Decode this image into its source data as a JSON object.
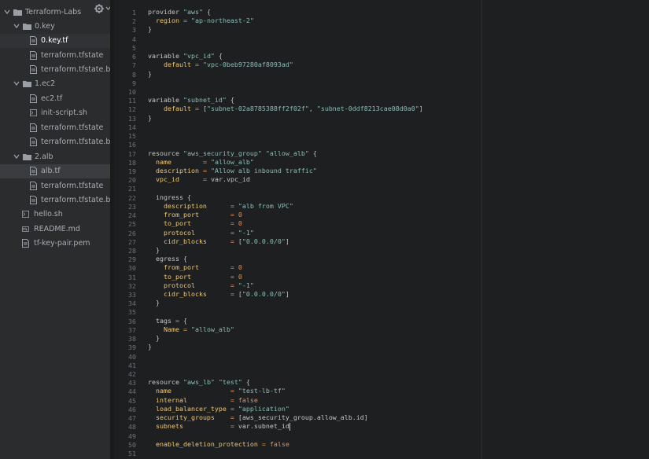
{
  "sidebar": {
    "root": "Terraform-Labs",
    "items": [
      {
        "label": "0.key",
        "type": "folder"
      },
      {
        "label": "0.key.tf",
        "type": "file"
      },
      {
        "label": "terraform.tfstate",
        "type": "file"
      },
      {
        "label": "terraform.tfstate.ba",
        "type": "file"
      },
      {
        "label": "1.ec2",
        "type": "folder"
      },
      {
        "label": "ec2.tf",
        "type": "file"
      },
      {
        "label": "init-script.sh",
        "type": "shell"
      },
      {
        "label": "terraform.tfstate",
        "type": "file"
      },
      {
        "label": "terraform.tfstate.ba",
        "type": "file"
      },
      {
        "label": "2.alb",
        "type": "folder"
      },
      {
        "label": "alb.tf",
        "type": "file"
      },
      {
        "label": "terraform.tfstate",
        "type": "file"
      },
      {
        "label": "terraform.tfstate.ba",
        "type": "file"
      },
      {
        "label": "hello.sh",
        "type": "shell"
      },
      {
        "label": "README.md",
        "type": "markdown"
      },
      {
        "label": "tf-key-pair.pem",
        "type": "file"
      }
    ],
    "settings_icon": "gear-icon"
  },
  "editor": {
    "line_numbers": [
      "1",
      "2",
      "3",
      "4",
      "5",
      "6",
      "7",
      "8",
      "9",
      "10",
      "11",
      "12",
      "13",
      "14",
      "15",
      "16",
      "17",
      "18",
      "19",
      "20",
      "21",
      "22",
      "23",
      "24",
      "25",
      "26",
      "27",
      "28",
      "29",
      "30",
      "31",
      "32",
      "33",
      "34",
      "35",
      "36",
      "37",
      "38",
      "39",
      "40",
      "41",
      "42",
      "43",
      "44",
      "45",
      "46",
      "47",
      "48",
      "49",
      "50",
      "51"
    ],
    "lines": [
      "provider \"aws\" {",
      "  region = \"ap-northeast-2\"",
      "}",
      "",
      "",
      "variable \"vpc_id\" {",
      "    default = \"vpc-0beb97280af8093ad\"",
      "}",
      "",
      "",
      "variable \"subnet_id\" {",
      "    default = [\"subnet-02a8785388ff2f02f\", \"subnet-0ddf8213cae08d0a0\"]",
      "}",
      "",
      "",
      "",
      "resource \"aws_security_group\" \"allow_alb\" {",
      "  name        = \"allow_alb\"",
      "  description = \"Allow alb inbound traffic\"",
      "  vpc_id      = var.vpc_id",
      "",
      "  ingress {",
      "    description      = \"alb from VPC\"",
      "    from_port        = 0",
      "    to_port          = 0",
      "    protocol         = \"-1\"",
      "    cidr_blocks      = [\"0.0.0.0/0\"]",
      "  }",
      "  egress {",
      "    from_port        = 0",
      "    to_port          = 0",
      "    protocol         = \"-1\"",
      "    cidr_blocks      = [\"0.0.0.0/0\"]",
      "  }",
      "",
      "  tags = {",
      "    Name = \"allow_alb\"",
      "  }",
      "}",
      "",
      "",
      "",
      "resource \"aws_lb\" \"test\" {",
      "  name               = \"test-lb-tf\"",
      "  internal           = false",
      "  load_balancer_type = \"application\"",
      "  security_groups    = [aws_security_group.allow_alb.id]",
      "  subnets            = var.subnet_id",
      "",
      "  enable_deletion_protection = false",
      ""
    ]
  },
  "theme": {
    "keyword": "#81a2be",
    "string": "#b5bd68",
    "number": "#de935f",
    "attribute": "#f0c674"
  }
}
